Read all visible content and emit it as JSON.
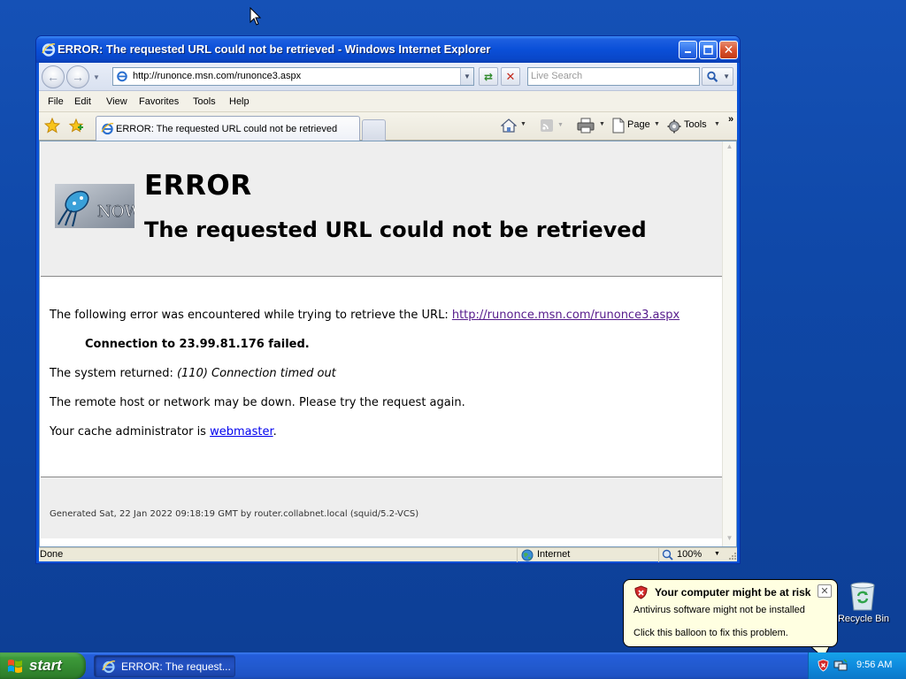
{
  "window": {
    "title": "ERROR: The requested URL could not be retrieved - Windows Internet Explorer",
    "minimize_label": "_",
    "maximize_label": "□",
    "close_label": "✕"
  },
  "address_bar": {
    "url": "http://runonce.msn.com/runonce3.aspx",
    "search_placeholder": "Live Search"
  },
  "menu": {
    "items": [
      "File",
      "Edit",
      "View",
      "Favorites",
      "Tools",
      "Help"
    ]
  },
  "tabs": {
    "active_label": "ERROR: The requested URL could not be retrieved"
  },
  "command_bar": {
    "page_label": "Page",
    "tools_label": "Tools",
    "more_label": "»"
  },
  "page": {
    "title": "ERROR",
    "subtitle": "The requested URL could not be retrieved",
    "logo_text": "NOW",
    "line1_prefix": "The following error was encountered while trying to retrieve the URL: ",
    "line1_link": "http://runonce.msn.com/runonce3.aspx",
    "line2": "Connection to 23.99.81.176 failed.",
    "line3_prefix": "The system returned: ",
    "line3_emph": "(110) Connection timed out",
    "line4": "The remote host or network may be down. Please try the request again.",
    "line5_prefix": "Your cache administrator is ",
    "line5_link": "webmaster",
    "line5_suffix": ".",
    "footer": "Generated Sat, 22 Jan 2022 09:18:19 GMT by router.collabnet.local (squid/5.2-VCS)"
  },
  "status_bar": {
    "status": "Done",
    "zone": "Internet",
    "zoom": "100%"
  },
  "desktop": {
    "recycle_bin_label": "Recycle Bin"
  },
  "balloon": {
    "title": "Your computer might be at risk",
    "line1": "Antivirus software might not be installed",
    "line2": "Click this balloon to fix this problem.",
    "close_label": "✕"
  },
  "taskbar": {
    "start_label": "start",
    "task_label": "ERROR: The request...",
    "clock": "9:56 AM"
  },
  "colors": {
    "desktop": "#0f48a8",
    "titlebar": "#0a4fd8",
    "start_green": "#3d9a3a",
    "tray_blue": "#0f8bde",
    "balloon_bg": "#ffffe1",
    "visited_link": "#551a8b",
    "link": "#0000ee"
  }
}
